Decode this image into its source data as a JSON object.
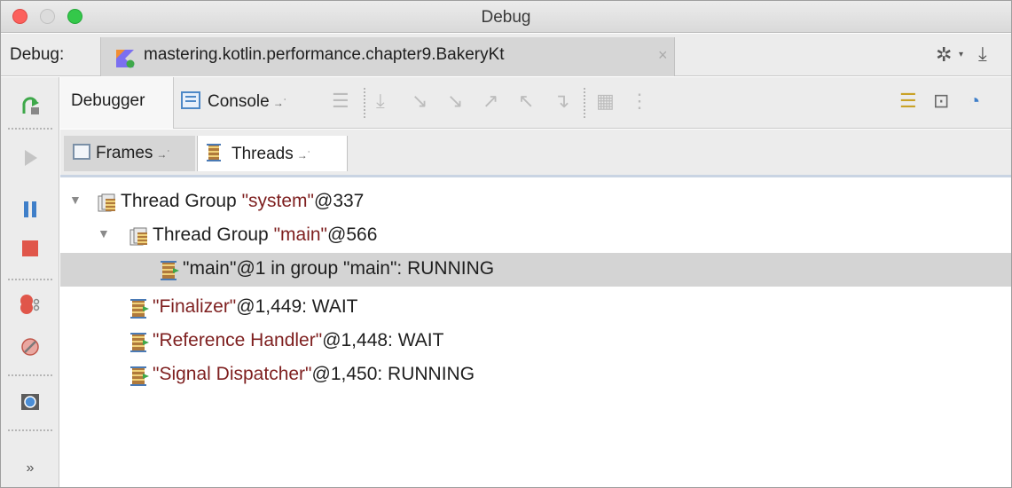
{
  "window": {
    "title": "Debug"
  },
  "tabbar": {
    "label": "Debug:",
    "run_tab": "mastering.kotlin.performance.chapter9.BakeryKt",
    "close_glyph": "×",
    "settings_icon": "gear-icon",
    "download_icon": "download-icon"
  },
  "toolbar": {
    "debugger_tab": "Debugger",
    "console_tab": "Console",
    "pin_glyph": "→˙"
  },
  "subtabs": {
    "frames": "Frames",
    "threads": "Threads",
    "pin_glyph": "→˙"
  },
  "leftbar": {
    "more_glyph": "»"
  },
  "tree": {
    "rows": [
      {
        "prefix": "Thread Group ",
        "quoted": "\"system\"",
        "suffix": "@337",
        "expanded": true,
        "level": 0,
        "type": "group"
      },
      {
        "prefix": "Thread Group ",
        "quoted": "\"main\"",
        "suffix": "@566",
        "expanded": true,
        "level": 1,
        "type": "group"
      },
      {
        "prefix": "",
        "quoted": "\"main\"",
        "suffix": "@1 in group \"main\": RUNNING",
        "level": 2,
        "type": "thread",
        "selected": true,
        "quoted_plain": true
      },
      {
        "prefix": "",
        "quoted": "\"Finalizer\"",
        "suffix": "@1,449: WAIT",
        "level": 1,
        "type": "thread"
      },
      {
        "prefix": "",
        "quoted": "\"Reference Handler\"",
        "suffix": "@1,448: WAIT",
        "level": 1,
        "type": "thread"
      },
      {
        "prefix": "",
        "quoted": "\"Signal Dispatcher\"",
        "suffix": "@1,450: RUNNING",
        "level": 1,
        "type": "thread"
      }
    ]
  },
  "colors": {
    "thread_name": "#7e1f1f",
    "selected_row": "#d4d4d4",
    "accent_green": "#3ea84a",
    "stop_red": "#e0564a",
    "pause_blue": "#3f7fc9"
  }
}
